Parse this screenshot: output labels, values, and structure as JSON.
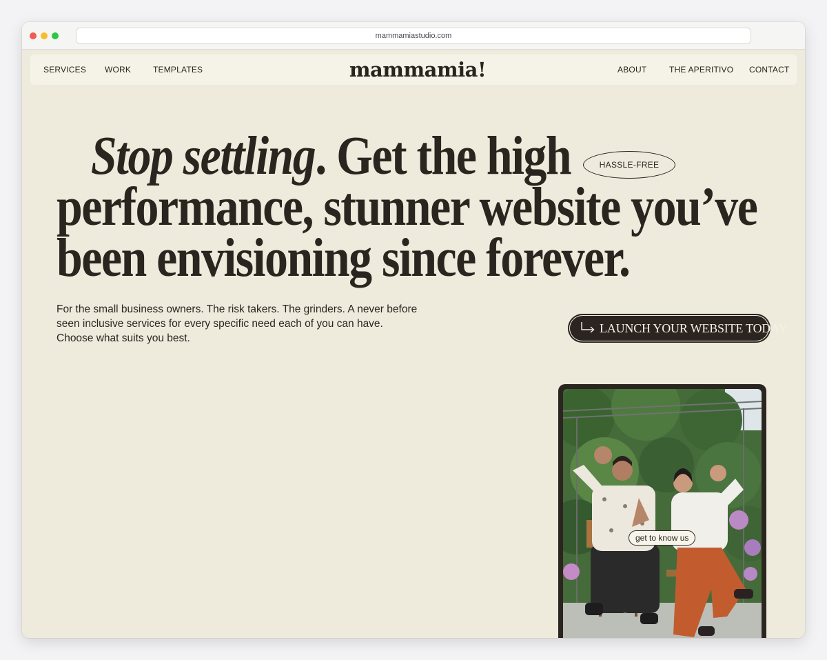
{
  "browser": {
    "url": "mammamiastudio.com"
  },
  "nav": {
    "left_links": [
      "SERVICES",
      "WORK",
      "TEMPLATES"
    ],
    "logo": "mammamia!",
    "right_links": [
      "ABOUT",
      "THE APERITIVO",
      "CONTACT"
    ]
  },
  "hero": {
    "headline_italic": "Stop settling",
    "headline_line1_rest": ". Get the high",
    "headline_line2": "performance, stunner website you’ve",
    "headline_line3": "been envisioning since forever.",
    "badge": "HASSLE-FREE",
    "subtext": "For the small business owners. The risk takers. The grinders. A never before seen inclusive services for every specific need each of you can have. Choose what suits you best.",
    "cta_label": "LAUNCH YOUR WEBSITE TODAY",
    "cta_icon": "arrow-right-turn-icon"
  },
  "video": {
    "pill_label": "get to know us"
  },
  "colors": {
    "page_bg": "#eeebdc",
    "nav_bg": "#f5f3e8",
    "ink": "#2b2520",
    "cta_bg": "#2b2420",
    "cta_text": "#f5f1e6"
  }
}
